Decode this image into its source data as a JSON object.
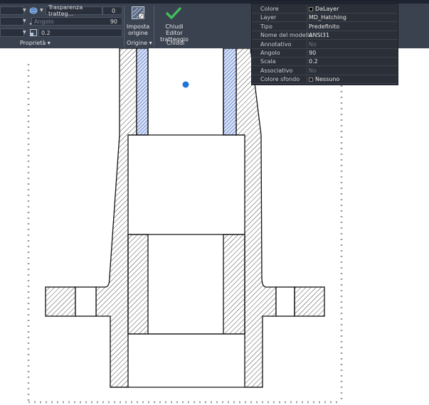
{
  "ribbon": {
    "rows": [
      {
        "label": "Trasparenza tratteg...",
        "value": "0"
      },
      {
        "label": "Angolo",
        "value": "90"
      },
      {
        "label": "",
        "value": "0.2"
      }
    ],
    "panels": {
      "properties": "Proprietà",
      "origin": "Origine",
      "close": "Chiudi"
    },
    "buttons": {
      "set_origin_line1": "Imposta",
      "set_origin_line2": "origine",
      "close_editor_line1": "Chiudi",
      "close_editor_line2": "Editor tratteggio"
    }
  },
  "properties_palette": {
    "rows": [
      {
        "label": "Colore",
        "value": "DaLayer",
        "dim": false,
        "swatch": "#000000"
      },
      {
        "label": "Layer",
        "value": "MD_Hatching",
        "dim": false
      },
      {
        "label": "Tipo",
        "value": "Predefinito",
        "dim": false
      },
      {
        "label": "Nome del modello",
        "value": "ANSI31",
        "dim": false
      },
      {
        "label": "Annotativo",
        "value": "No",
        "dim": true
      },
      {
        "label": "Angolo",
        "value": "90",
        "dim": false
      },
      {
        "label": "Scala",
        "value": "0.2",
        "dim": false
      },
      {
        "label": "Associativo",
        "value": "No",
        "dim": true
      },
      {
        "label": "Colore sfondo",
        "value": "Nessuno",
        "dim": false,
        "swatch": "#1a1a1a"
      }
    ]
  },
  "colors": {
    "ribbon_bg": "#3a4250",
    "palette_bg": "#2b2f38",
    "hatch_selected": "#2f57b8",
    "hatch_selected_fill": "#dbe4f7",
    "grip": "#1f74d6",
    "check": "#3fbf5b"
  }
}
